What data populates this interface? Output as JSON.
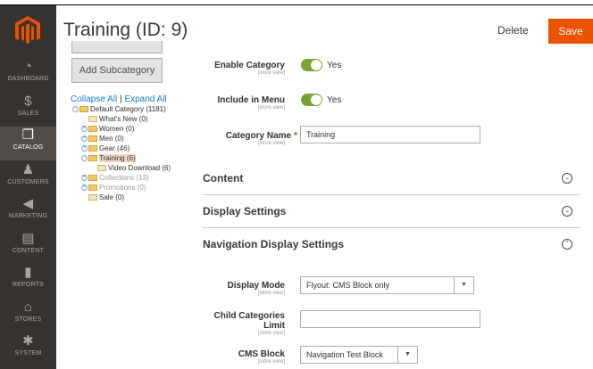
{
  "sidebar": {
    "items": [
      {
        "label": "DASHBOARD",
        "icon": "dashboard-icon",
        "glyph": "◔"
      },
      {
        "label": "SALES",
        "icon": "dollar-icon",
        "glyph": "$"
      },
      {
        "label": "CATALOG",
        "icon": "cube-icon",
        "glyph": "❒"
      },
      {
        "label": "CUSTOMERS",
        "icon": "person-icon",
        "glyph": "♟"
      },
      {
        "label": "MARKETING",
        "icon": "megaphone-icon",
        "glyph": "◀"
      },
      {
        "label": "CONTENT",
        "icon": "content-icon",
        "glyph": "▤"
      },
      {
        "label": "REPORTS",
        "icon": "bar-chart-icon",
        "glyph": "▮"
      },
      {
        "label": "STORES",
        "icon": "store-icon",
        "glyph": "⌂"
      },
      {
        "label": "SYSTEM",
        "icon": "gear-icon",
        "glyph": "✱"
      }
    ]
  },
  "header": {
    "title": "Training (ID: 9)",
    "delete_label": "Delete",
    "save_label": "Save"
  },
  "tree": {
    "add_subcategory": "Add Subcategory",
    "collapse_all": "Collapse All",
    "separator": "|",
    "expand_all": "Expand All",
    "nodes": [
      {
        "label": "Default Category (1181)",
        "type": "folder",
        "toggle": "−"
      },
      {
        "label": "What's New (0)",
        "type": "page",
        "toggle": ""
      },
      {
        "label": "Women (0)",
        "type": "folder",
        "toggle": "+"
      },
      {
        "label": "Men (0)",
        "type": "folder",
        "toggle": "+"
      },
      {
        "label": "Gear (46)",
        "type": "folder",
        "toggle": "+"
      },
      {
        "label": "Training (6)",
        "type": "folder",
        "toggle": "−"
      },
      {
        "label": "Video Download (6)",
        "type": "page",
        "toggle": ""
      },
      {
        "label": "Collections (13)",
        "type": "folder",
        "toggle": "+"
      },
      {
        "label": "Promotions (0)",
        "type": "folder",
        "toggle": "+"
      },
      {
        "label": "Sale (0)",
        "type": "page",
        "toggle": ""
      }
    ]
  },
  "form": {
    "enable_category": {
      "label": "Enable Category",
      "scope": "[store view]",
      "value": "Yes"
    },
    "include_in_menu": {
      "label": "Include in Menu",
      "scope": "[store view]",
      "value": "Yes"
    },
    "category_name": {
      "label": "Category Name",
      "required": "*",
      "scope": "[store view]",
      "value": "Training"
    }
  },
  "sections": {
    "content": "Content",
    "display_settings": "Display Settings",
    "navigation_display": "Navigation Display Settings"
  },
  "navigation": {
    "display_mode": {
      "label": "Display Mode",
      "scope": "[store view]",
      "value": "Flyout: CMS Block only"
    },
    "child_categories_limit": {
      "label_1": "Child Categories",
      "label_2": "Limit",
      "scope": "[store view]",
      "value": ""
    },
    "cms_block": {
      "label": "CMS Block",
      "scope": "[store view]",
      "value": "Navigation Test Block"
    }
  }
}
